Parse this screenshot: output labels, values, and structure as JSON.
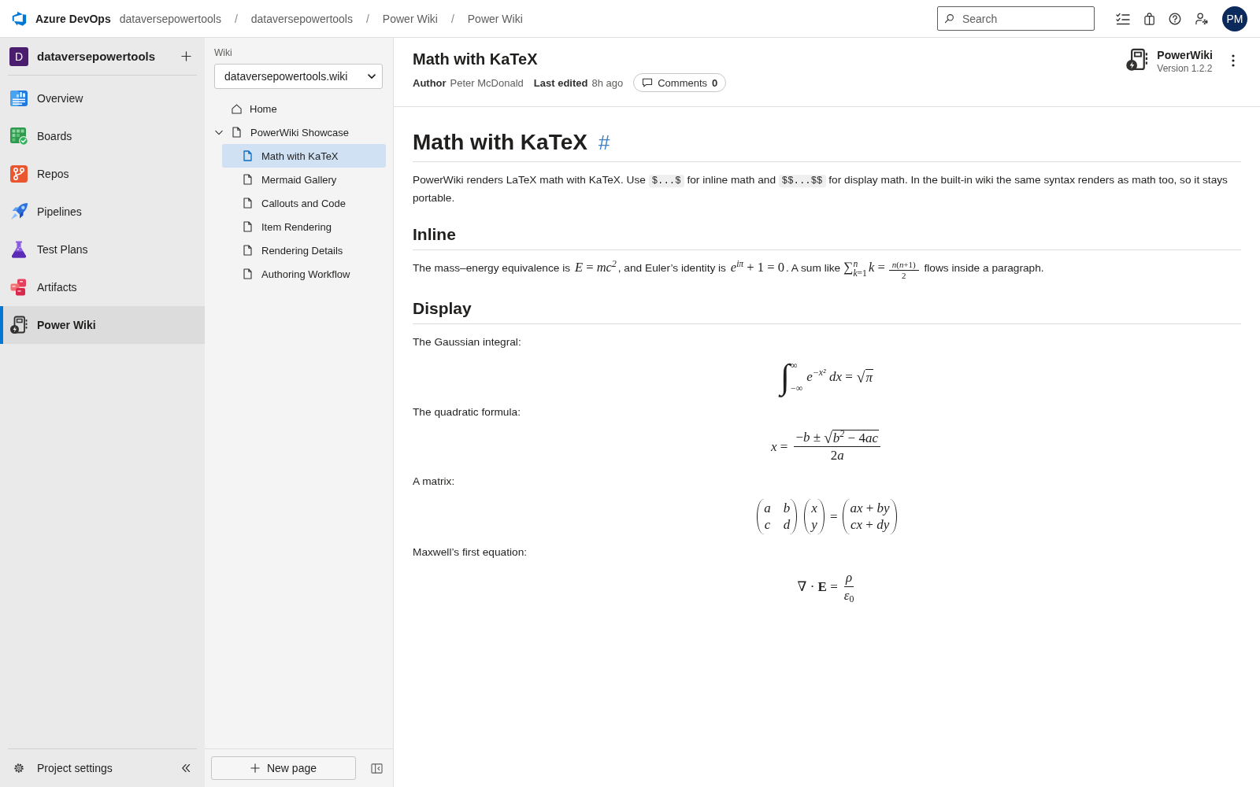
{
  "top_bar": {
    "product": "Azure DevOps",
    "breadcrumbs": [
      {
        "label": "dataversepowertools"
      },
      {
        "separator": "/",
        "label": "dataversepowertools"
      },
      {
        "separator": "/",
        "label": "Power Wiki"
      },
      {
        "separator": "/",
        "label": "Power Wiki"
      }
    ],
    "search": {
      "placeholder": "Search"
    },
    "avatar": "PM"
  },
  "project": {
    "initial": "D",
    "name": "dataversepowertools"
  },
  "nav": {
    "items": [
      {
        "kind": "overview",
        "label": "Overview",
        "selected": false
      },
      {
        "kind": "boards",
        "label": "Boards",
        "selected": false
      },
      {
        "kind": "repos",
        "label": "Repos",
        "selected": false
      },
      {
        "kind": "pipelines",
        "label": "Pipelines",
        "selected": false
      },
      {
        "kind": "test_plans",
        "label": "Test Plans",
        "selected": false
      },
      {
        "kind": "artifacts",
        "label": "Artifacts",
        "selected": false
      },
      {
        "kind": "wiki",
        "label": "Power Wiki",
        "selected": true
      }
    ],
    "footer": {
      "label": "Project settings"
    }
  },
  "wiki_panel": {
    "label": "Wiki",
    "selector": {
      "value": "dataversepowertools.wiki"
    },
    "tree": [
      {
        "kind": "home",
        "label": "Home",
        "selected": false
      },
      {
        "kind": "page",
        "label": "PowerWiki Showcase",
        "selected": false,
        "expanded": true,
        "children": [
          {
            "kind": "page",
            "label": "Math with KaTeX",
            "selected": true
          },
          {
            "kind": "page",
            "label": "Mermaid Gallery",
            "selected": false
          },
          {
            "kind": "page",
            "label": "Callouts and Code",
            "selected": false
          },
          {
            "kind": "page",
            "label": "Item Rendering",
            "selected": false
          },
          {
            "kind": "page",
            "label": "Rendering Details",
            "selected": false
          },
          {
            "kind": "page",
            "label": "Authoring Workflow",
            "selected": false
          }
        ]
      }
    ],
    "new_page_button": "New page"
  },
  "page_header": {
    "title": "Math with KaTeX",
    "author_label": "Author",
    "author": "Peter McDonald",
    "edited_label": "Last edited",
    "edited": "8h ago",
    "comments_label": "Comments",
    "comments_count": "0",
    "extension": {
      "name": "PowerWiki",
      "version": "Version 1.2.2"
    }
  },
  "article": {
    "heading": "Math with KaTeX",
    "anchor": "#",
    "blocks": [
      {
        "kind": "paragraph",
        "segments": [
          {
            "kind": "text",
            "text": "PowerWiki renders LaTeX math with KaTeX. Use "
          },
          {
            "kind": "code",
            "text": "$...$"
          },
          {
            "kind": "text",
            "text": " for inline math and "
          },
          {
            "kind": "code",
            "text": "$$...$$"
          },
          {
            "kind": "text",
            "text": " for display math. In the built-in wiki the same syntax renders as math too, so it stays portable."
          }
        ]
      },
      {
        "kind": "heading",
        "text": "Inline"
      },
      {
        "kind": "paragraph",
        "segments": [
          {
            "kind": "text",
            "text": "The mass–energy equivalence is "
          },
          {
            "kind": "math",
            "parts": [
              {
                "kind": "text",
                "text": "*E* = *mc*$^{2}$"
              }
            ]
          },
          {
            "kind": "text",
            "text": ", and Euler’s identity is "
          },
          {
            "kind": "math",
            "parts": [
              {
                "kind": "text",
                "text": "*e*$^{iπ}$ + 1 = 0"
              }
            ]
          },
          {
            "kind": "text",
            "text": ". A sum like "
          },
          {
            "kind": "math",
            "parts": [
              {
                "kind": "op",
                "symbol": "∑",
                "upper": "*n*",
                "lower": "*k*=1"
              },
              {
                "kind": "text",
                "text": "*k* ="
              },
              {
                "kind": "frac",
                "num": [
                  {
                    "kind": "text",
                    "text": "*n*(*n*+1)"
                  }
                ],
                "den": [
                  {
                    "kind": "text",
                    "text": "2"
                  }
                ]
              }
            ]
          },
          {
            "kind": "text",
            "text": " flows inside a paragraph."
          }
        ]
      },
      {
        "kind": "heading",
        "text": "Display"
      },
      {
        "kind": "paragraph",
        "segments": [
          {
            "kind": "text",
            "text": "The Gaussian integral:"
          }
        ]
      },
      {
        "kind": "equation",
        "parts": [
          {
            "kind": "op",
            "symbol": "∫",
            "upper": "∞",
            "lower": "−∞"
          },
          {
            "kind": "text",
            "text": "*e*$^{−x²}$ *dx* ="
          },
          {
            "kind": "sqrt",
            "symbol": "√",
            "body": [
              {
                "kind": "text",
                "text": "*π*"
              }
            ]
          }
        ]
      },
      {
        "kind": "paragraph",
        "segments": [
          {
            "kind": "text",
            "text": "The quadratic formula:"
          }
        ]
      },
      {
        "kind": "equation",
        "parts": [
          {
            "kind": "text",
            "text": "*x* ="
          },
          {
            "kind": "frac",
            "num": [
              {
                "kind": "text",
                "text": "−*b* ±"
              },
              {
                "kind": "sqrt",
                "symbol": "√",
                "body": [
                  {
                    "kind": "text",
                    "text": "*b*$^{2}$ − 4"
                  },
                  {
                    "kind": "text",
                    "text": "*ac*"
                  }
                ]
              }
            ],
            "den": [
              {
                "kind": "text",
                "text": "2"
              },
              {
                "kind": "text",
                "text": "*a*"
              }
            ]
          }
        ]
      },
      {
        "kind": "paragraph",
        "segments": [
          {
            "kind": "text",
            "text": "A matrix:"
          }
        ]
      },
      {
        "kind": "equation",
        "parts": [
          {
            "kind": "matrix",
            "rows": [
              [
                "*a*",
                "*b*"
              ],
              [
                "*c*",
                "*d*"
              ]
            ]
          },
          {
            "kind": "matrix",
            "rows": [
              [
                "*x*"
              ],
              [
                "*y*"
              ]
            ]
          },
          {
            "kind": "text",
            "text": "="
          },
          {
            "kind": "matrix",
            "rows": [
              [
                "*ax* + *by*"
              ],
              [
                "*cx* + *dy*"
              ]
            ]
          }
        ]
      },
      {
        "kind": "paragraph",
        "segments": [
          {
            "kind": "text",
            "text": "Maxwell’s first equation:"
          }
        ]
      },
      {
        "kind": "equation",
        "parts": [
          {
            "kind": "text",
            "text": "∇ · **E** ="
          },
          {
            "kind": "frac",
            "num": [
              {
                "kind": "text",
                "text": "*ρ*"
              }
            ],
            "den": [
              {
                "kind": "text",
                "text": "*ε*$_{0}$"
              }
            ]
          }
        ]
      }
    ]
  }
}
